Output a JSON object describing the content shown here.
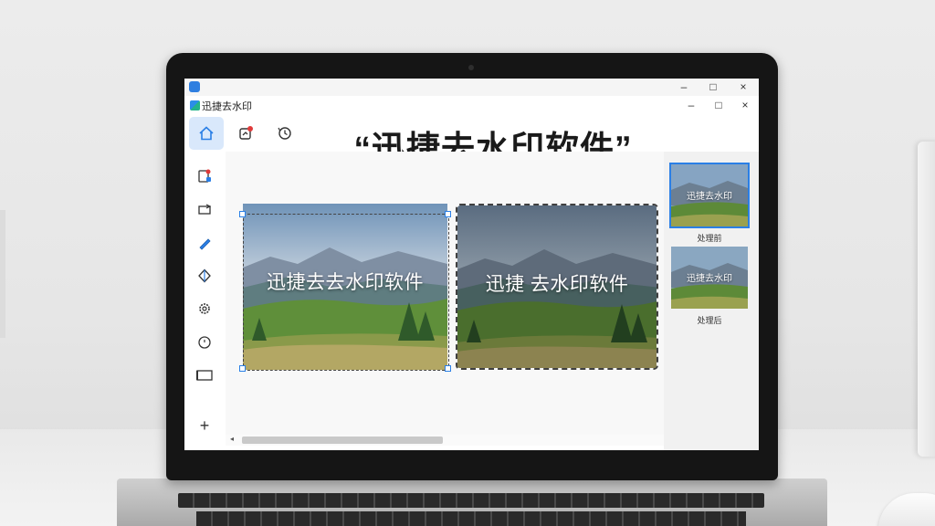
{
  "window": {
    "title": "迅捷去水印",
    "minimize": "–",
    "maximize": "□",
    "close": "×"
  },
  "headline": "“迅捷去水印软件”",
  "toolbar": {
    "items": [
      {
        "name": "home",
        "icon": "home-icon",
        "active": true
      },
      {
        "name": "edit",
        "icon": "edit-icon"
      },
      {
        "name": "history",
        "icon": "history-icon"
      }
    ]
  },
  "sidebar": {
    "items": [
      {
        "icon": "image-remove-icon"
      },
      {
        "icon": "crop-icon"
      },
      {
        "icon": "brush-icon"
      },
      {
        "icon": "erase-icon"
      },
      {
        "icon": "settings-icon"
      },
      {
        "icon": "clock-icon"
      },
      {
        "icon": "frame-icon"
      },
      {
        "icon": "plus-icon"
      }
    ],
    "add_label": "+"
  },
  "canvas": {
    "before_watermark": "迅捷去去水印软件",
    "after_watermark": "迅捷 去水印软件"
  },
  "right_panel": {
    "thumbnails": [
      {
        "watermark": "迅捷去水印",
        "caption": "处理前",
        "selected": true
      },
      {
        "watermark": "迅捷去水印",
        "caption": "处理后",
        "selected": false
      }
    ]
  },
  "colors": {
    "accent": "#2a7fe6",
    "active_tab_bg": "#d9e8fb",
    "headline": "#1a1a1a"
  }
}
